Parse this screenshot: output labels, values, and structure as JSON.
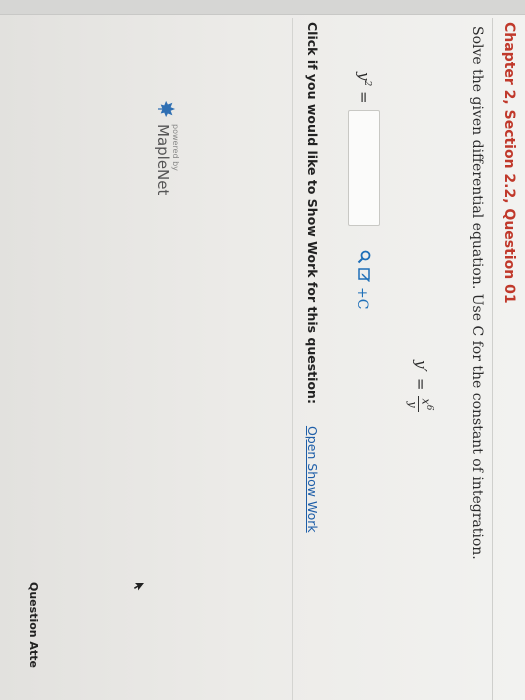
{
  "question": {
    "title": "Chapter 2, Section 2.2, Question 01",
    "instructions": "Solve the given differential equation. Use C for the constant of integration.",
    "equation": {
      "lhs": "y",
      "prime": "′",
      "equals": "=",
      "numerator": "x",
      "numerator_exp": "6",
      "denominator": "y"
    },
    "answer": {
      "label": "y",
      "label_exp": "2",
      "label_equals": " =",
      "value": "",
      "tools": {
        "search_icon": "search-icon",
        "edit_icon": "edit-icon",
        "plus_c": "+C"
      }
    },
    "show_work": {
      "prompt": "Click if you would like to Show Work for this question:",
      "link": "Open Show Work"
    }
  },
  "footer": {
    "powered_by": "powered by",
    "brand": "MapleNet",
    "question_attempts": "Question Atte"
  },
  "colors": {
    "title": "#c0392b",
    "link": "#1e5ea8",
    "tool": "#1e6fb8"
  }
}
